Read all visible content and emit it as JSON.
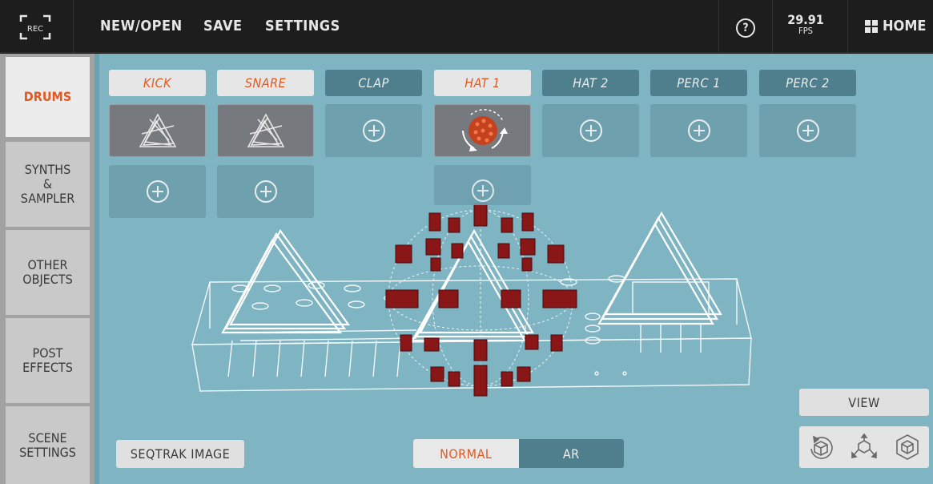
{
  "topbar": {
    "rec_label": "REC",
    "menu": [
      "NEW/OPEN",
      "SAVE",
      "SETTINGS"
    ],
    "help_icon": "?",
    "fps_value": "29.91",
    "fps_unit": "FPS",
    "home_label": "HOME"
  },
  "sidebar": {
    "items": [
      {
        "label": "DRUMS",
        "active": true
      },
      {
        "label": "SYNTHS\n&\nSAMPLER",
        "active": false
      },
      {
        "label": "OTHER\nOBJECTS",
        "active": false
      },
      {
        "label": "POST\nEFFECTS",
        "active": false
      },
      {
        "label": "SCENE\nSETTINGS",
        "active": false
      }
    ]
  },
  "tracks": [
    {
      "label": "KICK",
      "active": true,
      "object": "triangle-icon"
    },
    {
      "label": "SNARE",
      "active": true,
      "object": "triangle-icon"
    },
    {
      "label": "CLAP",
      "active": false
    },
    {
      "label": "HAT 1",
      "active": true,
      "object": "sphere-rotate-icon"
    },
    {
      "label": "HAT 2",
      "active": false
    },
    {
      "label": "PERC 1",
      "active": false
    },
    {
      "label": "PERC 2",
      "active": false
    }
  ],
  "buttons": {
    "seqtrak_image": "SEQTRAK IMAGE",
    "normal": "NORMAL",
    "ar": "AR",
    "view": "VIEW"
  },
  "colors": {
    "accent": "#e2581f",
    "scene_bg": "#7fb4c3",
    "track_off": "#4f7f8c"
  },
  "icons": [
    "rec-icon",
    "help-icon",
    "home-grid-icon",
    "plus-icon",
    "rotate-view-icon",
    "axis-view-icon",
    "cube-view-icon"
  ]
}
